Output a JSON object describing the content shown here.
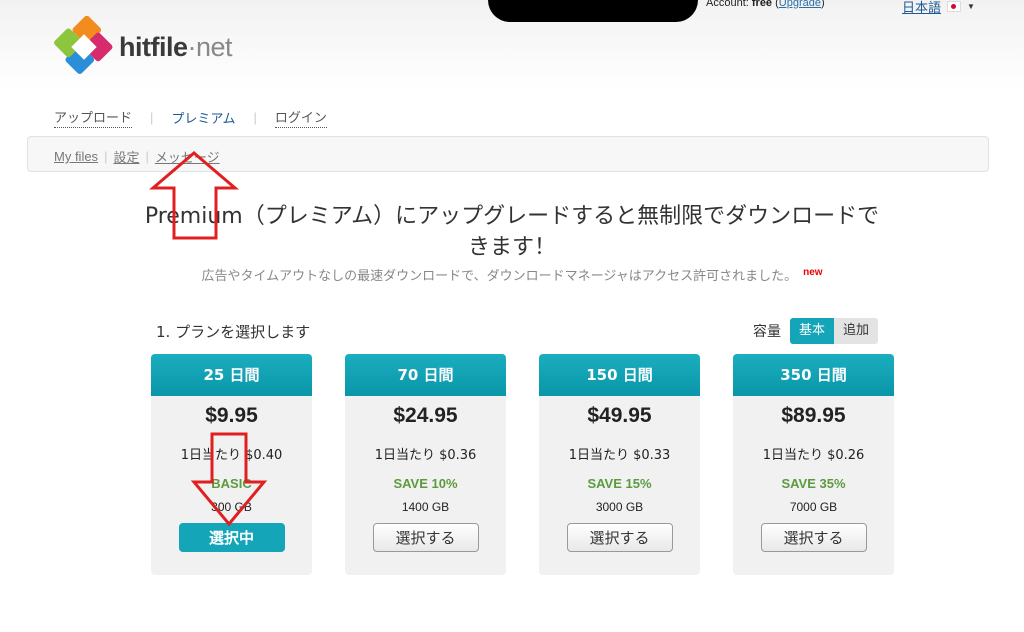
{
  "header": {
    "account_label": "Account:",
    "account_type": "free",
    "upgrade_label": "Upgrade",
    "language": "日本語"
  },
  "logo": {
    "hit": "hit",
    "file": "file",
    "dot": "·",
    "net": "net"
  },
  "nav": [
    {
      "label": "アップロード"
    },
    {
      "label": "プレミアム"
    },
    {
      "label": "ログイン"
    }
  ],
  "subnav": [
    {
      "label": "My files"
    },
    {
      "label": "設定"
    },
    {
      "label": "メッセージ"
    }
  ],
  "headline": "Premium（プレミアム）にアップグレードすると無制限でダウンロードできます！",
  "subline": "広告やタイムアウトなしの最速ダウンロードで、ダウンロードマネージャはアクセス許可されました。",
  "new_badge": "new",
  "step_title": "1. プランを選択します",
  "capacity": {
    "label": "容量",
    "options": [
      "基本",
      "追加"
    ],
    "selected": "基本"
  },
  "plans": [
    {
      "days": "25 日間",
      "price": "$9.95",
      "perday": "1日当たり $0.40",
      "save": "BASIC",
      "size": "300 GB",
      "button": "選択中",
      "selected": true
    },
    {
      "days": "70 日間",
      "price": "$24.95",
      "perday": "1日当たり $0.36",
      "save": "SAVE 10%",
      "size": "1400 GB",
      "button": "選択する",
      "selected": false
    },
    {
      "days": "150 日間",
      "price": "$49.95",
      "perday": "1日当たり $0.33",
      "save": "SAVE 15%",
      "size": "3000 GB",
      "button": "選択する",
      "selected": false
    },
    {
      "days": "350 日間",
      "price": "$89.95",
      "perday": "1日当たり $0.26",
      "save": "SAVE 35%",
      "size": "7000 GB",
      "button": "選択する",
      "selected": false
    }
  ],
  "colors": {
    "accent": "#14a5b8",
    "save_green": "#5b9b3e",
    "annotation_red": "#e02020",
    "link_blue": "#1f5a95"
  }
}
